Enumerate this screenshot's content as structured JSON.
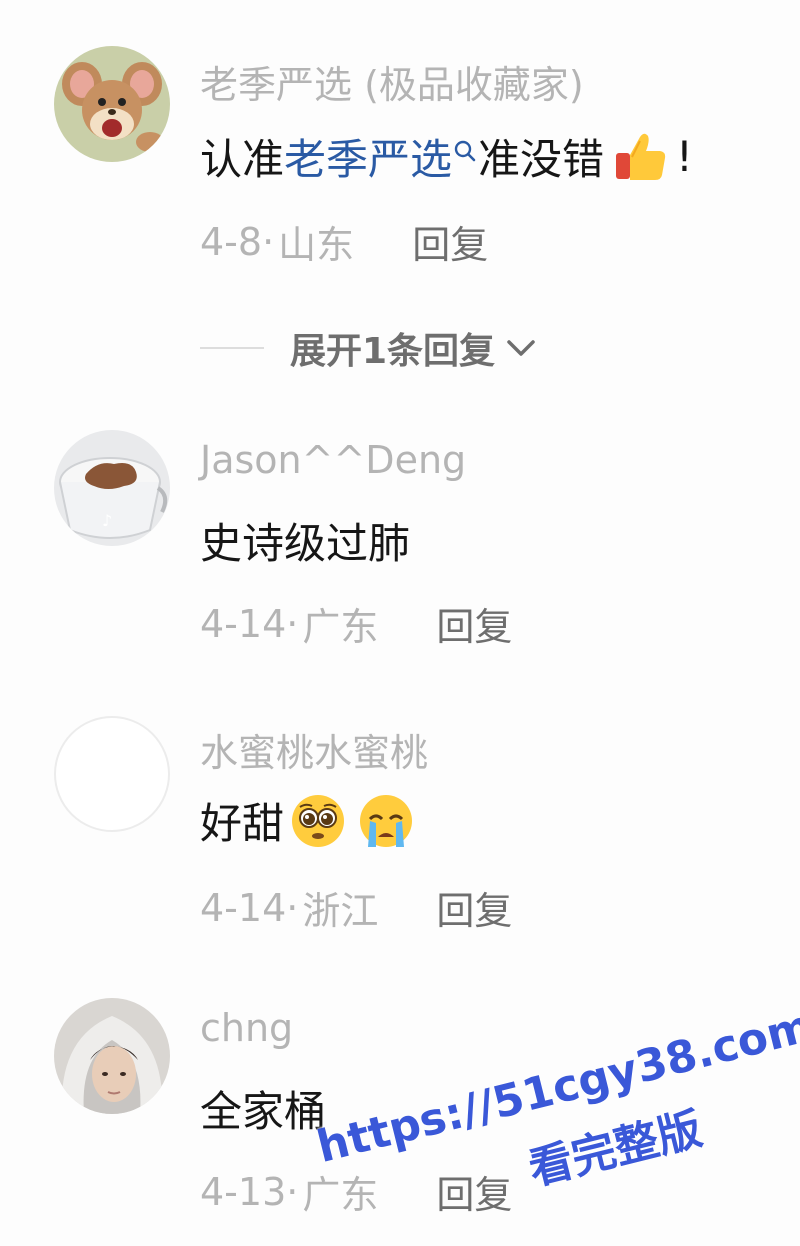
{
  "comments": [
    {
      "username": "老季严选 (极品收藏家)",
      "content_prefix": "认准",
      "content_link": "老季严选",
      "content_suffix": "准没错",
      "content_end": "!",
      "date": "4-8",
      "location": "山东",
      "reply_label": "回复",
      "avatar": "jerry-mouse-avatar",
      "emoji": [
        "thumbs-up-emoji"
      ]
    },
    {
      "username": "Jason^^Deng",
      "content": "史诗级过肺",
      "date": "4-14",
      "location": "广东",
      "reply_label": "回复",
      "avatar": "coffee-cup-avatar"
    },
    {
      "username": "水蜜桃水蜜桃",
      "content": "好甜",
      "date": "4-14",
      "location": "浙江",
      "reply_label": "回复",
      "avatar": "blank-avatar",
      "emoji": [
        "pleading-face-emoji",
        "crying-face-emoji"
      ]
    },
    {
      "username": "chng",
      "content": "全家桶",
      "date": "4-13",
      "location": "广东",
      "reply_label": "回复",
      "avatar": "hooded-person-avatar"
    }
  ],
  "expand_replies": {
    "label": "展开1条回复",
    "icon": "chevron-down-icon"
  },
  "watermark": {
    "url": "https://51cgy38.com",
    "subtitle": "看完整版"
  },
  "colors": {
    "username": "#b4b4b4",
    "content": "#161616",
    "link": "#2a5aa4",
    "reply": "#6e6e6e",
    "watermark": "#3a58d8"
  }
}
